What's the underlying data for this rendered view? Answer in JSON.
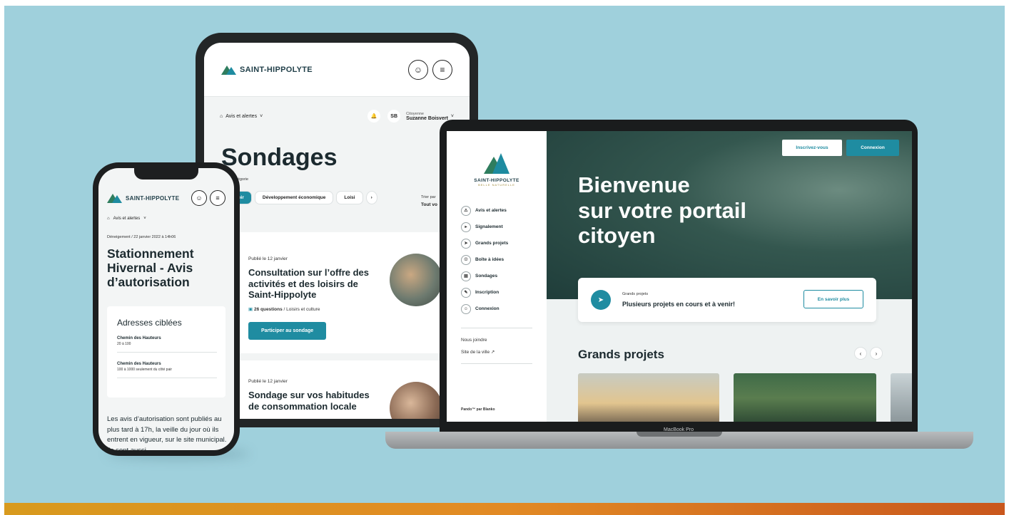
{
  "colors": {
    "background": "#9fd0dc",
    "accent": "#1f8ca1",
    "dark_text": "#1c2a2f",
    "bottom_stripe": "#e28a24"
  },
  "tablet": {
    "logo_text": "SAINT-HIPPOLYTE",
    "breadcrumb": "Avis et alertes",
    "user_initials": "SB",
    "user_role": "Citoyenne",
    "user_name": "Suzanne Boisvert",
    "page_title": "Sondages",
    "filter_label": "par catégorie",
    "filters": [
      "t voir",
      "Développement économique",
      "Loisi"
    ],
    "sort_label": "Trier par",
    "sort_value": "Tout vo",
    "card1": {
      "date": "Publié le 12 janvier",
      "title": "Consultation sur l’offre des activités et des loisirs de Saint-Hippolyte",
      "questions": "26 questions",
      "category": "Loisirs et culture",
      "button": "Participer au sondage"
    },
    "card2": {
      "date": "Publié le 12 janvier",
      "title": "Sondage sur vos habitudes de consommation locale"
    }
  },
  "laptop": {
    "logo_text": "SAINT-HIPPOLYTE",
    "logo_sub": "BELLE NATURELLE",
    "nav": [
      {
        "label": "Avis et alertes",
        "icon": "warning-icon"
      },
      {
        "label": "Signalement",
        "icon": "megaphone-icon"
      },
      {
        "label": "Grands projets",
        "icon": "rocket-icon"
      },
      {
        "label": "Boîte à idées",
        "icon": "lightbulb-icon"
      },
      {
        "label": "Sondages",
        "icon": "survey-icon"
      },
      {
        "label": "Inscription",
        "icon": "edit-icon"
      },
      {
        "label": "Connexion",
        "icon": "user-icon"
      }
    ],
    "contact": "Nous joindre",
    "city_site": "Site de la ville",
    "credit": "Pando™ par Blanko",
    "hero_title": [
      "Bienvenue",
      "sur votre portail",
      "citoyen"
    ],
    "signup_button": "Inscrivez-vous",
    "login_button": "Connexion",
    "info_label": "Grands projets",
    "info_title": "Plusieurs projets en cours et à venir!",
    "info_button": "En savoir plus",
    "section_title": "Grands projets",
    "device_label": "MacBook Pro"
  },
  "phone": {
    "logo_text": "SAINT-HIPPOLYTE",
    "breadcrumb": "Avis et alertes",
    "meta": "Déneigement / 22 janvier 2022 à 14h06",
    "title": "Stationnement Hivernal - Avis d’autorisation",
    "box_title": "Adresses ciblées",
    "addresses": [
      {
        "street": "Chemin des Hauteurs",
        "detail": "20 à 100"
      },
      {
        "street": "Chemin des Hauteurs",
        "detail": "100 à 1000 seulement du côté pair"
      }
    ],
    "body": "Les avis d’autorisation sont publiés au plus tard à 17h, la veille du jour où ils entrent en vigueur, sur le site municipal. Ils sont aussi"
  }
}
